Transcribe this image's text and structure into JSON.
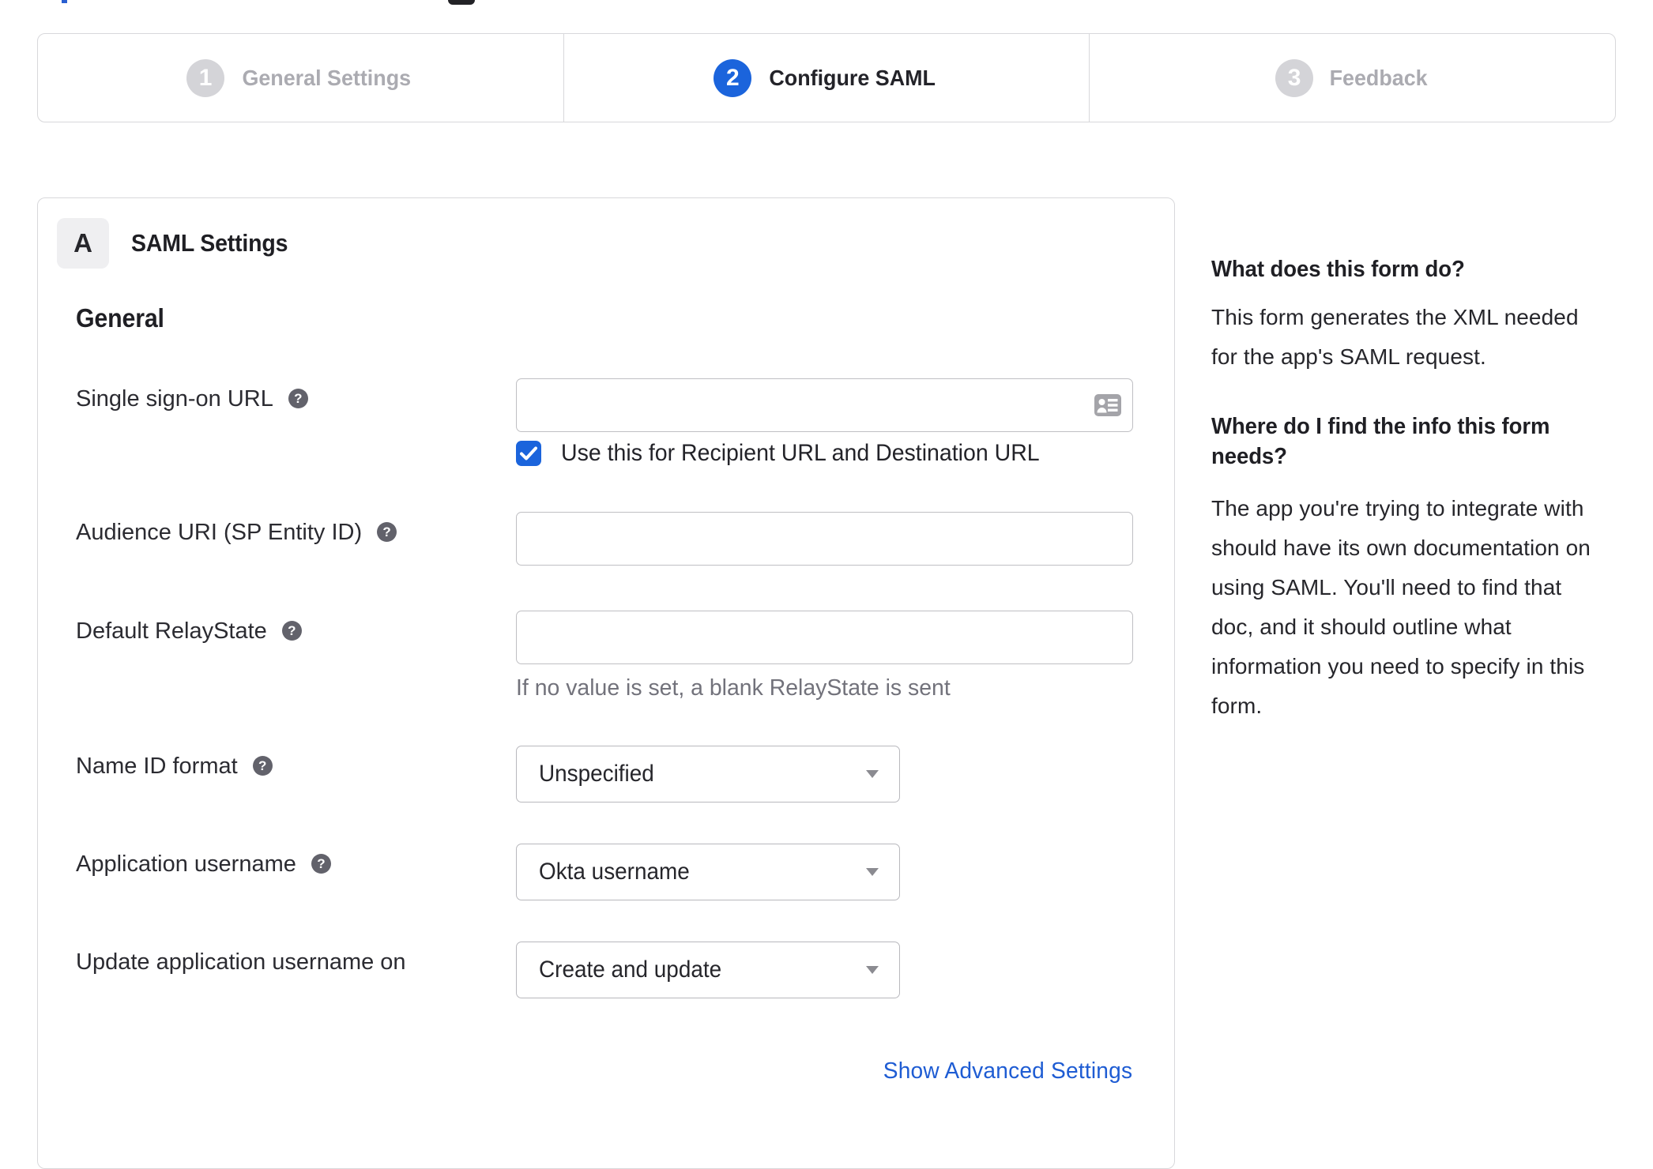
{
  "page": {
    "title_fragments_note": "bottom edge of a cut-off page heading"
  },
  "stepper": {
    "steps": [
      {
        "number": "1",
        "label": "General Settings",
        "state": "inactive"
      },
      {
        "number": "2",
        "label": "Configure SAML",
        "state": "active"
      },
      {
        "number": "3",
        "label": "Feedback",
        "state": "inactive"
      }
    ]
  },
  "panel": {
    "section_badge": "A",
    "section_title": "SAML Settings",
    "group_heading": "General",
    "fields": [
      {
        "label": "Single sign-on URL",
        "has_help_icon": true,
        "type": "text",
        "value": "",
        "trailing_icon": "contact-card",
        "checkbox": {
          "checked": true,
          "label": "Use this for Recipient URL and Destination URL"
        }
      },
      {
        "label": "Audience URI (SP Entity ID)",
        "has_help_icon": true,
        "type": "text",
        "value": ""
      },
      {
        "label": "Default RelayState",
        "has_help_icon": true,
        "type": "text",
        "value": "",
        "helper_text": "If no value is set, a blank RelayState is sent"
      },
      {
        "label": "Name ID format",
        "has_help_icon": true,
        "type": "select",
        "value": "Unspecified"
      },
      {
        "label": "Application username",
        "has_help_icon": true,
        "type": "select",
        "value": "Okta username"
      },
      {
        "label": "Update application username on",
        "has_help_icon": false,
        "type": "select",
        "value": "Create and update"
      }
    ],
    "advanced_link": "Show Advanced Settings"
  },
  "help": {
    "section1": {
      "heading": "What does this form do?",
      "body_lines": [
        "This form generates the XML needed",
        "for the app's SAML request."
      ]
    },
    "section2": {
      "heading_lines": [
        "Where do I find the info this form",
        "needs?"
      ],
      "body_lines": [
        "The app you're trying to integrate with",
        "should have its own documentation on",
        "using SAML. You'll need to find that",
        "doc, and it should outline what",
        "information you need to specify in this",
        "form."
      ]
    }
  },
  "colors": {
    "accent_blue": "#1b64dc",
    "link_blue": "#1e5cd3",
    "inactive_grey": "#d4d4d8",
    "border_grey": "#d8d8db",
    "text_dark": "#26262b"
  }
}
